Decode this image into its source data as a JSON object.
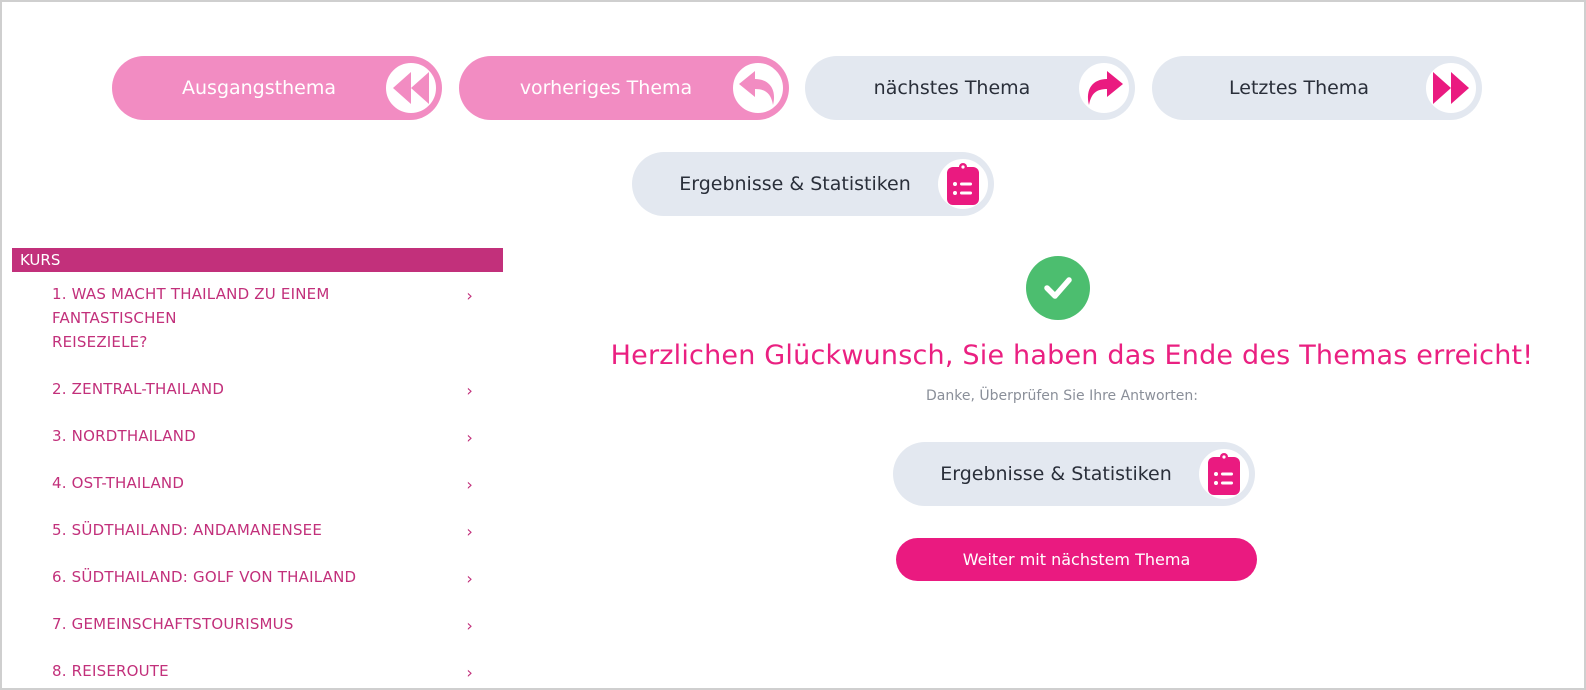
{
  "nav": {
    "first_label": "Ausgangsthema",
    "prev_label": "vorheriges Thema",
    "next_label": "nächstes Thema",
    "last_label": "Letztes Thema",
    "stats_label": "Ergebnisse & Statistiken"
  },
  "sidebar": {
    "header": "KURS",
    "items": [
      {
        "line1": "1. WAS MACHT THAILAND ZU EINEM FANTASTISCHEN",
        "line2": "REISEZIELE?"
      },
      {
        "line1": "2. ZENTRAL-THAILAND"
      },
      {
        "line1": "3. NORDTHAILAND"
      },
      {
        "line1": "4. OST-THAILAND"
      },
      {
        "line1": "5. SÜDTHAILAND: ANDAMANENSEE"
      },
      {
        "line1": "6. SÜDTHAILAND: GOLF VON THAILAND"
      },
      {
        "line1": "7. GEMEINSCHAFTSTOURISMUS"
      },
      {
        "line1": "8. REISEROUTE"
      }
    ],
    "chevron": "›"
  },
  "main": {
    "congrats": "Herzlichen Glückwunsch, Sie haben das Ende des Themas erreicht!",
    "thanks": "Danke, Überprüfen Sie Ihre Antworten:",
    "stats_label": "Ergebnisse & Statistiken",
    "continue_label": "Weiter mit nächstem Thema"
  },
  "colors": {
    "pink_light": "#f28cc2",
    "pink_accent": "#ea1a80",
    "magenta_header": "#c2307b",
    "grey_button": "#e3e8f0",
    "success_green": "#4cbe6f"
  },
  "icons": {
    "first": "rewind-icon",
    "prev": "undo-arrow-icon",
    "next": "redo-arrow-icon",
    "last": "fast-forward-icon",
    "stats": "clipboard-list-icon",
    "success": "check-icon"
  }
}
